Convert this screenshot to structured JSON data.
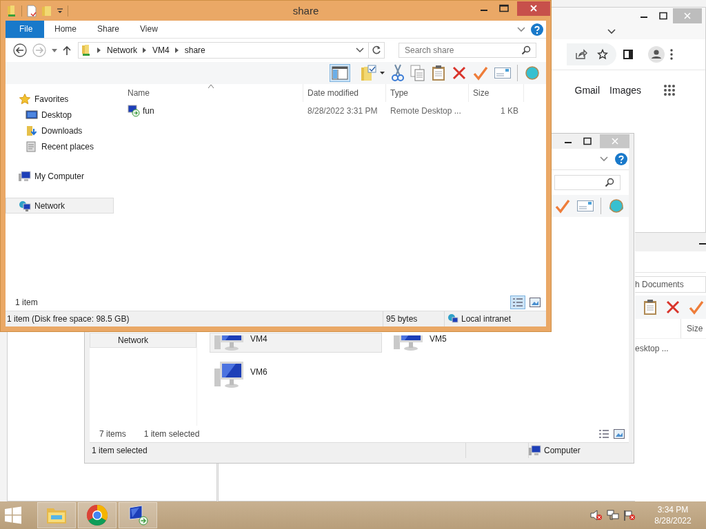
{
  "browser": {
    "links": [
      {
        "label": "Gmail"
      },
      {
        "label": "Images"
      }
    ]
  },
  "explorer_back": {
    "nav": [
      {
        "label": "Network",
        "selected": true
      }
    ],
    "items": [
      {
        "label": "VM4",
        "selected": true
      },
      {
        "label": "VM5",
        "selected": false
      },
      {
        "label": "VM6",
        "selected": false
      }
    ],
    "item_count": "7 items",
    "selection_count": "1 item selected",
    "status": {
      "selection": "1 item selected",
      "zone": "Computer"
    }
  },
  "explorer_third": {
    "search_text": "h Documents",
    "column": "Size",
    "row_type": "esktop ..."
  },
  "explorer_front": {
    "title": "share",
    "ribbon_tabs": [
      {
        "label": "File",
        "kind": "menu"
      },
      {
        "label": "Home",
        "kind": "tab"
      },
      {
        "label": "Share",
        "kind": "tab"
      },
      {
        "label": "View",
        "kind": "tab"
      }
    ],
    "address": [
      "Network",
      "VM4",
      "share"
    ],
    "search": {
      "placeholder": "Search share"
    },
    "nav": [
      {
        "label": "Favorites",
        "kind": "favorites",
        "selected": false,
        "children": [
          {
            "label": "Desktop",
            "kind": "desktop",
            "selected": false
          },
          {
            "label": "Downloads",
            "kind": "downloads",
            "selected": false
          },
          {
            "label": "Recent places",
            "kind": "recent",
            "selected": false
          }
        ]
      },
      {
        "label": "My Computer",
        "kind": "computer",
        "selected": false
      },
      {
        "label": "Network",
        "kind": "network",
        "selected": true
      }
    ],
    "columns": [
      {
        "label": "Name",
        "sorted": true
      },
      {
        "label": "Date modified",
        "sorted": false
      },
      {
        "label": "Type",
        "sorted": false
      },
      {
        "label": "Size",
        "sorted": false
      }
    ],
    "files": [
      {
        "name": "fun",
        "date_modified": "8/28/2022 3:31 PM",
        "type": "Remote Desktop ...",
        "size": "1 KB"
      }
    ],
    "item_count": "1 item",
    "status": {
      "info": "1 item (Disk free space: 98.5 GB)",
      "size": "95 bytes",
      "zone": "Local intranet"
    }
  },
  "taskbar": {
    "apps": [
      {
        "kind": "explorer"
      },
      {
        "kind": "chrome"
      },
      {
        "kind": "remote"
      }
    ],
    "clock": {
      "time": "3:34 PM",
      "date": "8/28/2022"
    }
  }
}
